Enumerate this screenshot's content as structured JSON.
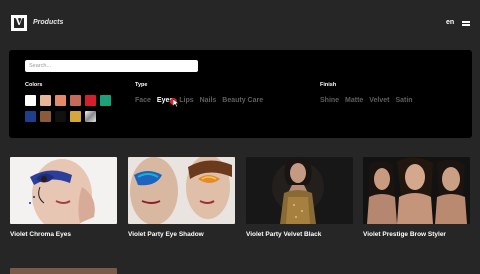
{
  "header": {
    "logo_letter": "V",
    "title": "Products",
    "language": "en"
  },
  "filters": {
    "search_placeholder": "Search...",
    "colors_label": "Colors",
    "type_label": "Type",
    "finish_label": "Finish",
    "swatches": [
      "#ffffff",
      "#e8b597",
      "#e28a6a",
      "#c66a5a",
      "#d4202b",
      "#1aa37a",
      "#1e3f8c",
      "#8a5a3a",
      "#111111",
      "#d6a53c",
      "#c8c8c8"
    ],
    "types": [
      "Face",
      "Eyes",
      "Lips",
      "Nails",
      "Beauty Care"
    ],
    "selected_type": "Eyes",
    "finishes": [
      "Shine",
      "Matte",
      "Velvet",
      "Satin"
    ]
  },
  "products": [
    {
      "name": "Violet Chroma Eyes"
    },
    {
      "name": "Violet Party Eye Shadow"
    },
    {
      "name": "Violet Party Velvet Black"
    },
    {
      "name": "Violet Prestige Brow Styler"
    }
  ]
}
